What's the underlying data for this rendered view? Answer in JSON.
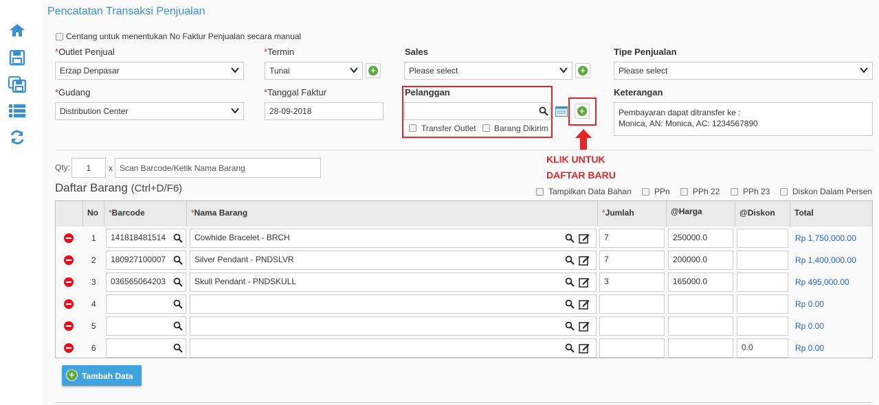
{
  "title": "Pencatatan Transaksi Penjualan",
  "manual_check_label": "Centang untuk menentukan No Faktur Penjualan secara manual",
  "fields": {
    "outlet_label": "Outlet Penjual",
    "outlet_value": "Erzap Denpasar",
    "termin_label": "Termin",
    "termin_value": "Tunai",
    "sales_label": "Sales",
    "sales_value": "Please select",
    "tipe_label": "Tipe Penjualan",
    "tipe_value": "Please select",
    "gudang_label": "Gudang",
    "gudang_value": "Distribution Center",
    "tanggal_label": "Tanggal Faktur",
    "tanggal_value": "28-09-2018",
    "pelanggan_label": "Pelanggan",
    "pelanggan_value": "",
    "transfer_outlet": "Transfer Outlet",
    "barang_dikirim": "Barang Dikirim",
    "keterangan_label": "Keterangan",
    "keterangan_line1": "Pembayaran dapat ditransfer ke :",
    "keterangan_line2": "Monica, AN: Monica, AC: 1234567890",
    "required_mark": "*"
  },
  "annotation": {
    "line1": "KLIK UNTUK",
    "line2": "DAFTAR BARU"
  },
  "qty": {
    "label": "Qty:",
    "value": "1",
    "x": "x",
    "scan_placeholder": "Scan Barcode/Ketik Nama Barang"
  },
  "list": {
    "title": "Daftar Barang",
    "shortcut": "(Ctrl+D/F6)",
    "options": [
      "Tampilkan Data Bahan",
      "PPn",
      "PPh 22",
      "PPh 23",
      "Diskon Dalam Persen"
    ]
  },
  "table": {
    "headers": {
      "no": "No",
      "barcode": "Barcode",
      "nama": "Nama Barang",
      "jumlah": "Jumlah",
      "harga": "@Harga",
      "diskon": "@Diskon",
      "total": "Total"
    },
    "rows": [
      {
        "no": "1",
        "barcode": "141818481514",
        "nama": "Cowhide Bracelet - BRCH",
        "jumlah": "7",
        "harga": "250000.0",
        "diskon": "",
        "total": "Rp 1,750,000.00"
      },
      {
        "no": "2",
        "barcode": "180927100007",
        "nama": "Silver Pendant - PNDSLVR",
        "jumlah": "7",
        "harga": "200000.0",
        "diskon": "",
        "total": "Rp 1,400,000.00"
      },
      {
        "no": "3",
        "barcode": "036565064203",
        "nama": "Skull Pendant - PNDSKULL",
        "jumlah": "3",
        "harga": "165000.0",
        "diskon": "",
        "total": "Rp 495,000.00"
      },
      {
        "no": "4",
        "barcode": "",
        "nama": "",
        "jumlah": "",
        "harga": "",
        "diskon": "",
        "total": "Rp 0.00"
      },
      {
        "no": "5",
        "barcode": "",
        "nama": "",
        "jumlah": "",
        "harga": "",
        "diskon": "",
        "total": "Rp 0.00"
      },
      {
        "no": "6",
        "barcode": "",
        "nama": "",
        "jumlah": "",
        "harga": "",
        "diskon": "0.0",
        "total": "Rp 0.00"
      }
    ]
  },
  "add_button": "Tambah Data",
  "colors": {
    "accent": "#3a8fd0",
    "annotation": "#e32626",
    "add": "#5aab3c",
    "remove": "#e0121d",
    "total": "#2266cc"
  }
}
